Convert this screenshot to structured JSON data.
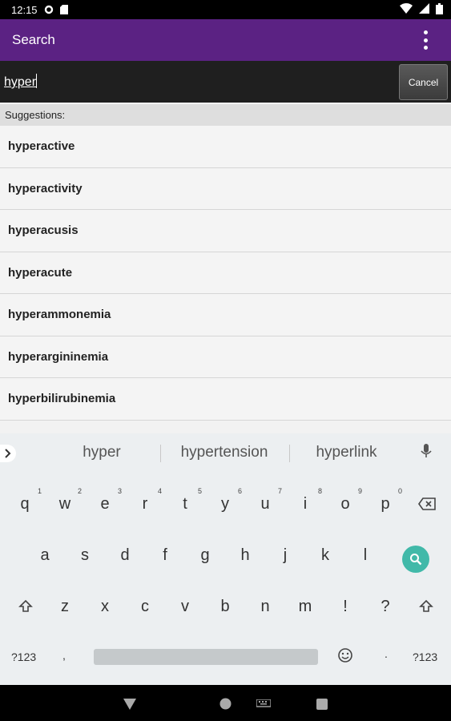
{
  "status_bar": {
    "time": "12:15",
    "icons": [
      "gear-icon",
      "sd-card-icon",
      "wifi-icon",
      "signal-icon",
      "battery-icon"
    ]
  },
  "app_bar": {
    "title": "Search",
    "menu_icon": "overflow-menu-icon"
  },
  "search": {
    "value": "hyper",
    "cancel_label": "Cancel"
  },
  "suggestions": {
    "header": "Suggestions:",
    "items": [
      "hyperactive",
      "hyperactivity",
      "hyperacusis",
      "hyperacute",
      "hyperammonemia",
      "hyperargininemia",
      "hyperbilirubinemia"
    ]
  },
  "keyboard": {
    "predictions": [
      "hyper",
      "hypertension",
      "hyperlink"
    ],
    "row1": [
      {
        "k": "q",
        "n": "1"
      },
      {
        "k": "w",
        "n": "2"
      },
      {
        "k": "e",
        "n": "3"
      },
      {
        "k": "r",
        "n": "4"
      },
      {
        "k": "t",
        "n": "5"
      },
      {
        "k": "y",
        "n": "6"
      },
      {
        "k": "u",
        "n": "7"
      },
      {
        "k": "i",
        "n": "8"
      },
      {
        "k": "o",
        "n": "9"
      },
      {
        "k": "p",
        "n": "0"
      }
    ],
    "row2": [
      "a",
      "s",
      "d",
      "f",
      "g",
      "h",
      "j",
      "k",
      "l"
    ],
    "row3": [
      "z",
      "x",
      "c",
      "v",
      "b",
      "n",
      "m",
      "!",
      "?"
    ],
    "symbols_label": "?123",
    "comma": ",",
    "period": ".",
    "symbols_label_right": "?123"
  },
  "colors": {
    "app_bar": "#5b2283",
    "search_key": "#41b9a9"
  }
}
